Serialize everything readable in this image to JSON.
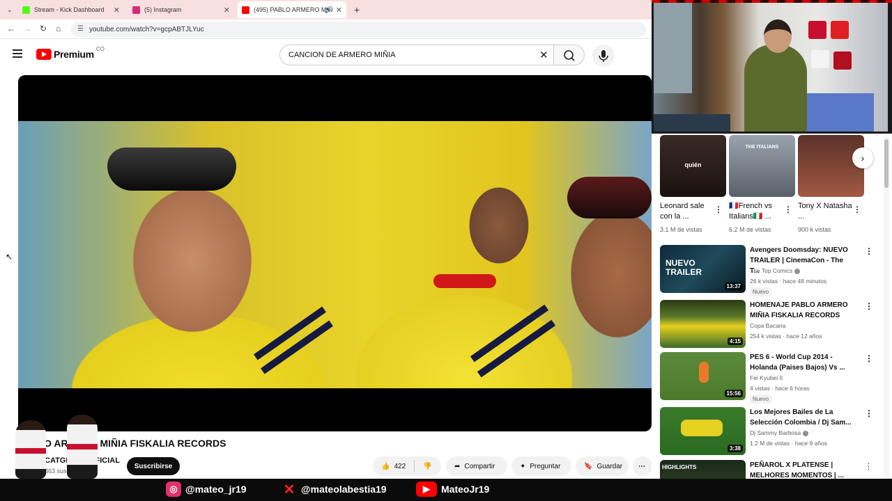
{
  "browser": {
    "tabs": [
      {
        "label": "Stream - Kick Dashboard",
        "color": "#53fc18"
      },
      {
        "label": "(5) Instagram",
        "color": "#d62976"
      },
      {
        "label": "(495) PABLO ARMERO MIÑ",
        "color": "#ff0000"
      }
    ],
    "url": "youtube.com/watch?v=gcpABTJLYuc"
  },
  "youtube": {
    "logo_text": "Premium",
    "country_code": "CO",
    "search_query": "CANCION DE ARMERO MIÑIA"
  },
  "video": {
    "title": "PABLO ARMERO MIÑIA FISKALIA RECORDS",
    "channel": "CATGREEN OFICIAL",
    "subscribers": "463 suscriptores",
    "subscribe_label": "Suscribirse",
    "likes": "422",
    "share_label": "Compartir",
    "ask_label": "Preguntar",
    "save_label": "Guardar"
  },
  "shorts": [
    {
      "title": "Leonard sale con la ...",
      "views": "3.1 M de vistas",
      "overlay": "quién"
    },
    {
      "title": "🇫🇷French vs Italians🇮🇹 ...",
      "views": "6.2 M de vistas",
      "overlay": "THE ITALIANS"
    },
    {
      "title": "Tony X Natasha ...",
      "views": "900 k vistas",
      "overlay": ""
    }
  ],
  "recommendations": [
    {
      "title": "Avengers Doomsday: NUEVO TRAILER | CinemaCon - The T...",
      "channel": "The Top Comics",
      "verified": true,
      "meta": "26 k vistas · hace 48 minutos",
      "duration": "13:37",
      "badge": "Nuevo",
      "thumb_text": "NUEVO TRAILER"
    },
    {
      "title": "HOMENAJE PABLO ARMERO MIÑIA FISKALIA RECORDS",
      "channel": "Copa Bacana",
      "verified": false,
      "meta": "254 k vistas · hace 12 años",
      "duration": "4:15",
      "badge": "",
      "thumb_text": ""
    },
    {
      "title": "PES 6 - World Cup 2014 - Holanda (Paises Bajos) Vs ...",
      "channel": "Fei Kyubei II",
      "verified": false,
      "meta": "4 vistas · hace 6 horas",
      "duration": "15:56",
      "badge": "Nuevo",
      "thumb_text": ""
    },
    {
      "title": "Los Mejores Bailes de La Selección Colombia / Dj Sam...",
      "channel": "Dj Sammy Barbosa",
      "verified": true,
      "meta": "1.2 M de vistas · hace 9 años",
      "duration": "3:38",
      "badge": "",
      "thumb_text": ""
    },
    {
      "title": "PEÑAROL X PLATENSE | MELHORES MOMENTOS | ...",
      "channel": "",
      "verified": false,
      "meta": "",
      "duration": "",
      "badge": "",
      "thumb_text": "HIGHLIGHTS"
    }
  ],
  "socials": [
    {
      "handle": "@mateo_jr19",
      "icon": "instagram-icon",
      "color": "#e1306c"
    },
    {
      "handle": "@mateolabestia19",
      "icon": "x-icon",
      "color": "#ff2222"
    },
    {
      "handle": "MateoJr19",
      "icon": "youtube-icon",
      "color": "#ff0000"
    }
  ]
}
